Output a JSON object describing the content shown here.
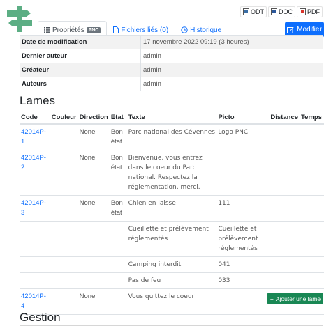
{
  "tabs": [
    {
      "label": "Propriétés",
      "badge": "PNC",
      "active": true,
      "icon": "list-icon"
    },
    {
      "label": "Fichiers liés (0)",
      "active": false,
      "icon": "file-icon"
    },
    {
      "label": "Historique",
      "active": false,
      "icon": "clock-icon"
    }
  ],
  "exports": {
    "odt": "ODT",
    "doc": "DOC",
    "pdf": "PDF"
  },
  "edit_button": "Modifier",
  "properties": [
    {
      "key": "Date de modification",
      "value": "17 novembre 2022 09:19 (3 heures)"
    },
    {
      "key": "Dernier auteur",
      "value": "admin"
    },
    {
      "key": "Créateur",
      "value": "admin"
    },
    {
      "key": "Auteurs",
      "value": "admin"
    }
  ],
  "lames": {
    "title": "Lames",
    "headers": [
      "Code",
      "Couleur",
      "Direction",
      "Etat",
      "Texte",
      "Picto",
      "Distance",
      "Temps"
    ],
    "rows": [
      {
        "code": "42014P-1",
        "couleur": "",
        "direction": "None",
        "etat": "Bon état",
        "texte": "Parc national des Cévennes",
        "picto": "Logo PNC",
        "distance": "",
        "temps": ""
      },
      {
        "code": "42014P-2",
        "couleur": "",
        "direction": "None",
        "etat": "Bon état",
        "texte": "Bienvenue, vous entrez dans le coeur du Parc national. Respectez la réglementation, merci.",
        "picto": "",
        "distance": "",
        "temps": ""
      },
      {
        "code": "42014P-3",
        "couleur": "",
        "direction": "None",
        "etat": "Bon état",
        "texte": "Chien en laisse",
        "picto": "111",
        "distance": "",
        "temps": ""
      },
      {
        "code": "",
        "couleur": "",
        "direction": "",
        "etat": "",
        "texte": "Cueillette et prélèvement réglementés",
        "picto": "Cueillette et prélèvement réglementés",
        "distance": "",
        "temps": ""
      },
      {
        "code": "",
        "couleur": "",
        "direction": "",
        "etat": "",
        "texte": "Camping interdit",
        "picto": "041",
        "distance": "",
        "temps": ""
      },
      {
        "code": "",
        "couleur": "",
        "direction": "",
        "etat": "",
        "texte": "Pas de feu",
        "picto": "033",
        "distance": "",
        "temps": ""
      },
      {
        "code": "42014P-4",
        "couleur": "",
        "direction": "None",
        "etat": "",
        "texte": "Vous quittez le coeur",
        "picto": "",
        "distance": "",
        "temps": ""
      }
    ],
    "add_button": "Ajouter une lame"
  },
  "gestion": {
    "title": "Gestion"
  },
  "colors": {
    "primary": "#0d6efd",
    "success": "#198754",
    "logo": "#5cae84"
  }
}
